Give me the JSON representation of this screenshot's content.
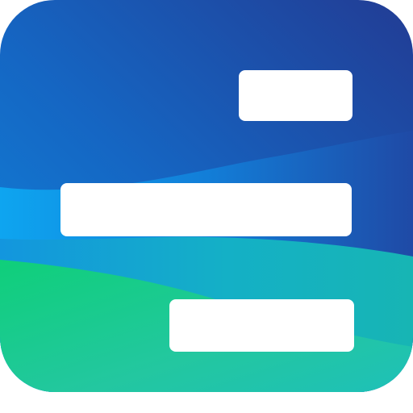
{
  "app_icon": {
    "name": "timeline-bars-icon",
    "bar_count": 3,
    "colors": {
      "background_blue_dark": "#1f3f96",
      "background_blue_mid": "#1565c0",
      "background_blue_light": "#1ea8f2",
      "background_teal": "#14b5b5",
      "background_green": "#14cc78",
      "bar_fill": "#ffffff"
    }
  }
}
